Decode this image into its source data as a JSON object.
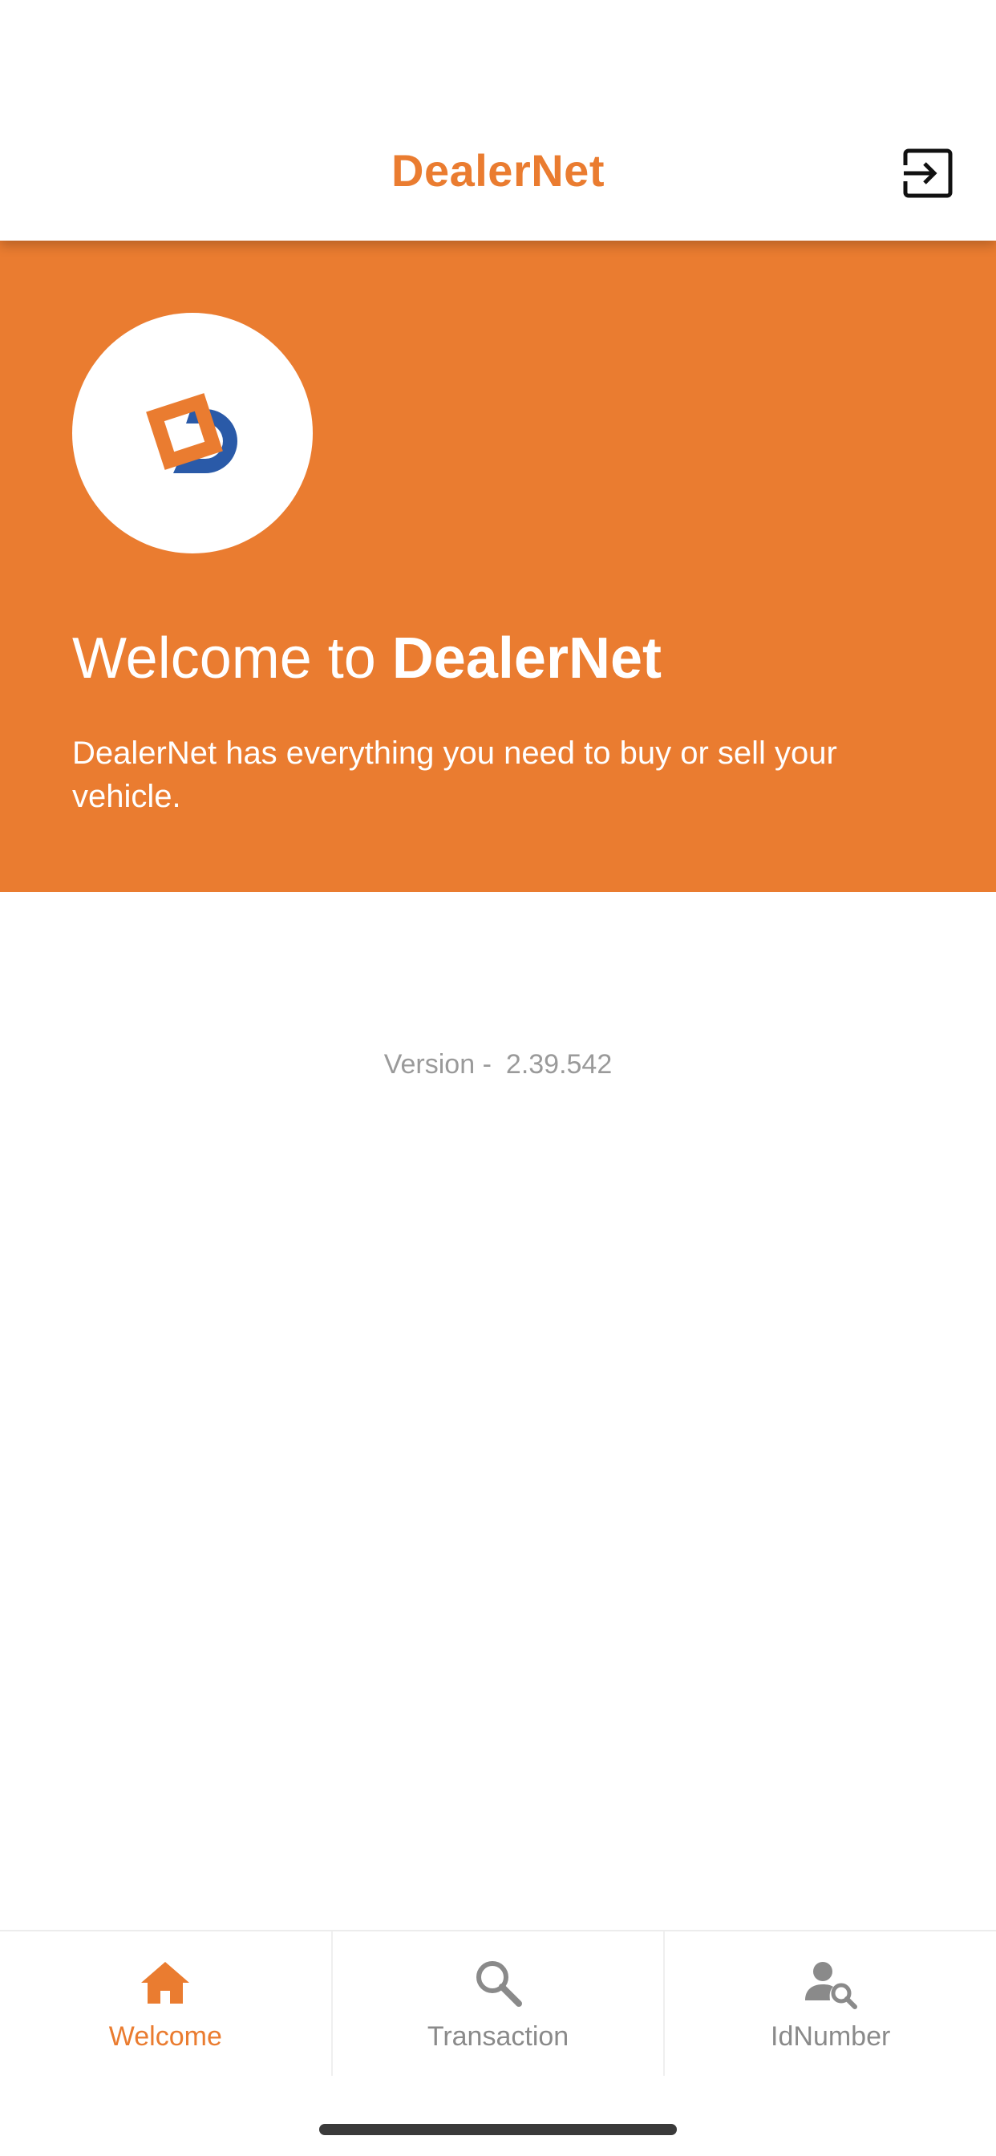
{
  "header": {
    "title": "DealerNet",
    "logout_icon": "logout-icon"
  },
  "hero": {
    "logo_icon": "dealernet-logo",
    "welcome_prefix": "Welcome to ",
    "welcome_brand": "DealerNet",
    "description": "DealerNet has everything you need to buy or sell your vehicle."
  },
  "version": {
    "label": "Version -",
    "number": "2.39.542"
  },
  "tabs": [
    {
      "label": "Welcome",
      "icon": "home-icon",
      "active": true
    },
    {
      "label": "Transaction",
      "icon": "search-icon",
      "active": false
    },
    {
      "label": "IdNumber",
      "icon": "user-search-icon",
      "active": false
    }
  ],
  "colors": {
    "accent": "#EA7C30",
    "logo_blue": "#2A5AA8",
    "inactive": "#8a8a8a"
  }
}
